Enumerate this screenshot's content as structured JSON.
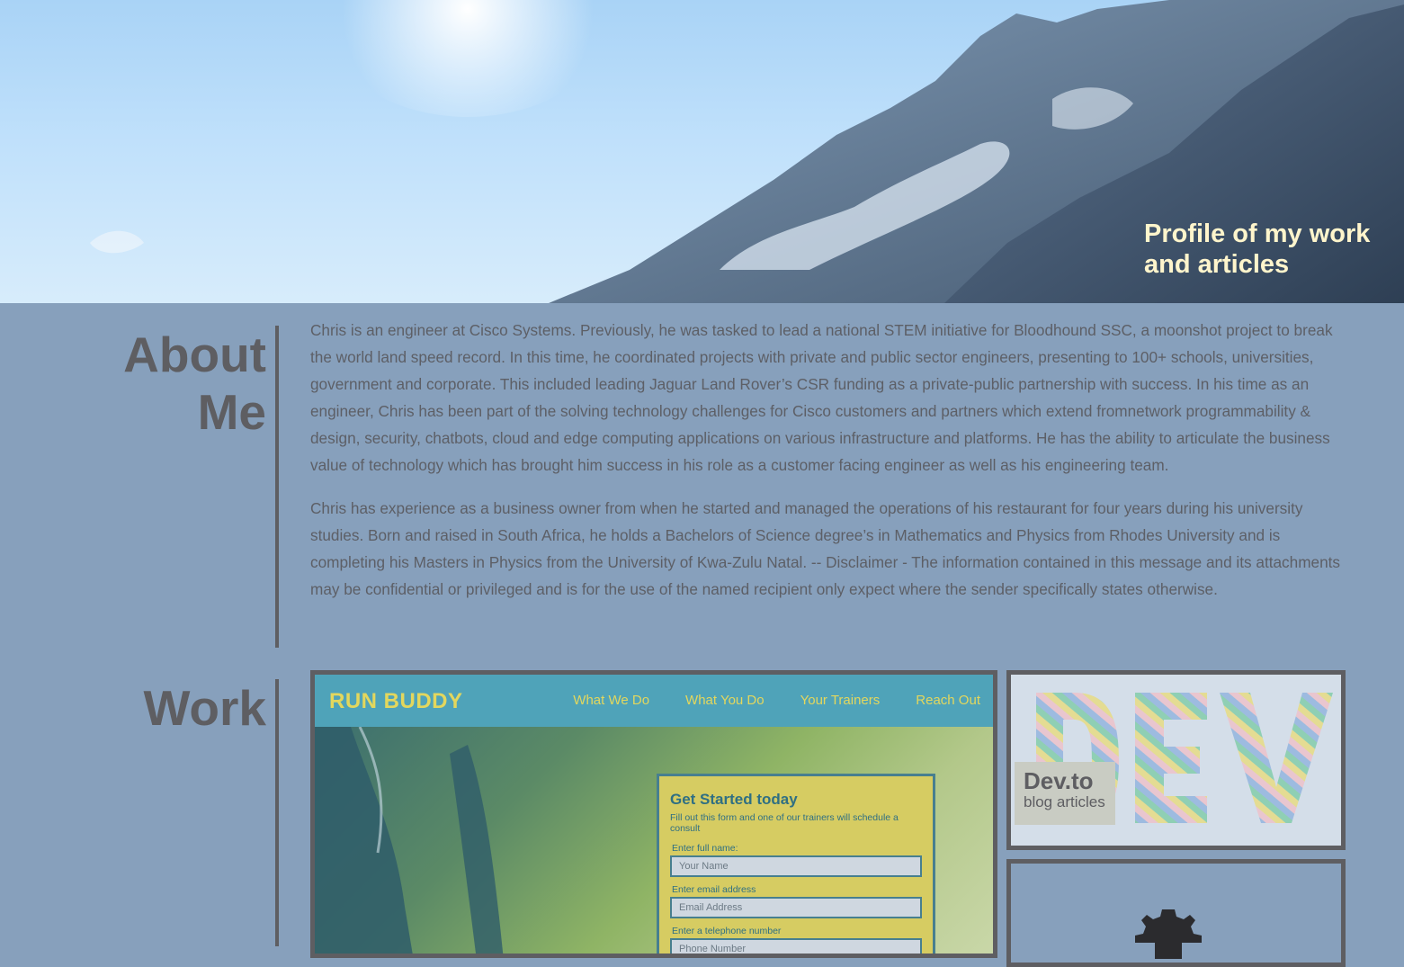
{
  "hero": {
    "title": "Profile of my work and articles",
    "image": "mountain-sky-banner"
  },
  "about": {
    "heading": "About Me",
    "paragraphs": [
      "Chris is an engineer at Cisco Systems. Previously, he was tasked to lead a national STEM initiative for Bloodhound SSC, a moonshot project to break the world land speed record. In this time, he coordinated projects with private and public sector engineers, presenting to 100+ schools, universities, government and corporate. This included leading Jaguar Land Rover’s CSR funding as a private-public partnership with success. In his time as an engineer, Chris has been part of the solving technology challenges for Cisco customers and partners which extend fromnetwork programmability & design, security, chatbots, cloud and edge computing applications on various infrastructure and platforms. He has the ability to articulate the business value of technology which has brought him success in his role as a customer facing engineer as well as his engineering team.",
      "Chris has experience as a business owner from when he started and managed the operations of his restaurant for four years during his university studies. Born and raised in South Africa, he holds a Bachelors of Science degree’s in Mathematics and Physics from Rhodes University and is completing his Masters in Physics from the University of Kwa-Zulu Natal. -- Disclaimer - The information contained in this message and its attachments may be confidential or  privileged and is for the use of the named recipient only expect where the sender specifically states otherwise."
    ]
  },
  "work": {
    "heading": "Work",
    "run_buddy": {
      "logo": "RUN BUDDY",
      "nav": [
        "What We Do",
        "What You Do",
        "Your Trainers",
        "Reach Out"
      ],
      "form": {
        "title": "Get Started today",
        "subtitle": "Fill out this form and one of our trainers will schedule a consult",
        "fields": [
          {
            "label": "Enter full name:",
            "placeholder": "Your Name"
          },
          {
            "label": "Enter email address",
            "placeholder": "Email Address"
          },
          {
            "label": "Enter a telephone number",
            "placeholder": "Phone Number"
          }
        ]
      }
    },
    "dev": {
      "logo_text": "DEV",
      "caption_title": "Dev.to",
      "caption_subtitle": "blog articles"
    },
    "third_card_icon": "gear-icon"
  },
  "colors": {
    "page_bg": "#87a0bc",
    "heading": "#5e5e62",
    "hero_title": "#fff5cc",
    "runbuddy_nav": "#4fa3b9",
    "runbuddy_accent": "#e3d75d"
  }
}
